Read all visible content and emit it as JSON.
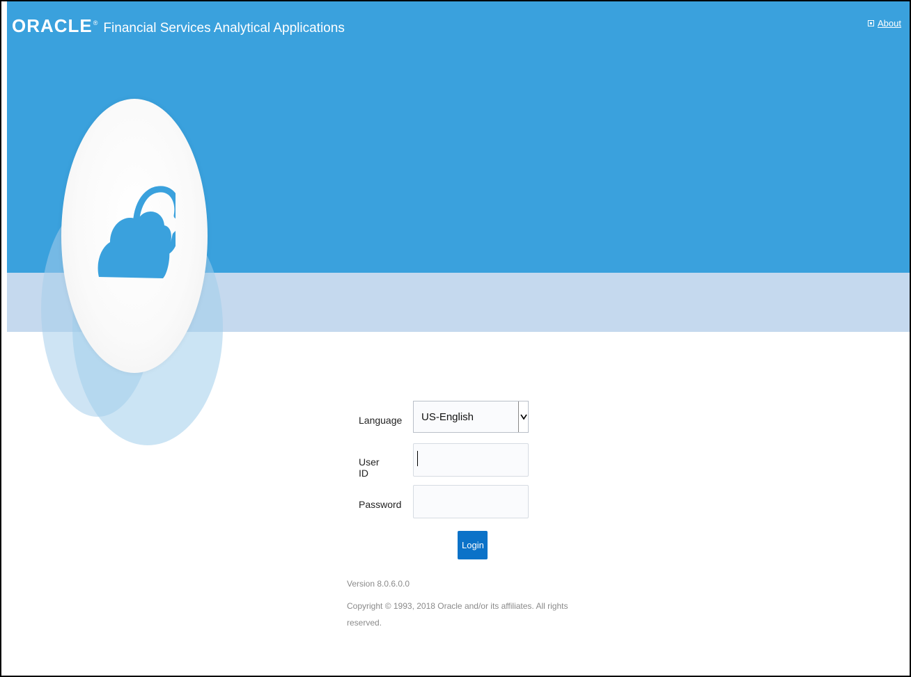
{
  "header": {
    "logo_word": "ORACLE",
    "logo_tm": "®",
    "title": "Financial Services Analytical Applications",
    "about_label": "About"
  },
  "login": {
    "language_label": "Language",
    "language_selected": "US-English",
    "user_id_label": "User ID",
    "user_id_value": "",
    "password_label": "Password",
    "password_value": "",
    "login_button": "Login"
  },
  "footer": {
    "version": "Version 8.0.6.0.0",
    "copyright_line1": "Copyright © 1993, 2018 Oracle and/or its affiliates. All rights",
    "copyright_line2": "reserved."
  },
  "colors": {
    "hero_blue": "#3aa1dd",
    "hero_band": "#c5d9ee",
    "button_blue": "#0b72c8",
    "cloud_blue": "#3aa1dd"
  },
  "icons": {
    "hero": "cloud-icon",
    "about": "info-icon",
    "select": "chevron-down-icon"
  }
}
